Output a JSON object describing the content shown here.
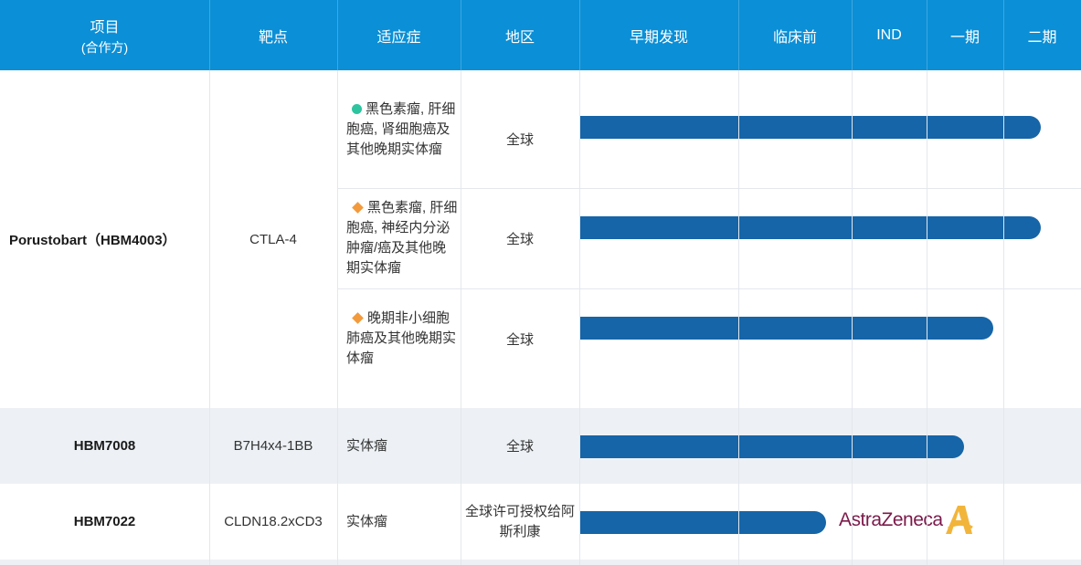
{
  "header": {
    "project": "项目",
    "project_sub": "(合作方)",
    "target": "靶点",
    "indication": "适应症",
    "region": "地区",
    "stages": [
      "早期发现",
      "临床前",
      "IND",
      "一期",
      "二期"
    ]
  },
  "rows": [
    {
      "project": "Porustobart（HBM4003）",
      "target": "CTLA-4",
      "sub_rows": [
        {
          "marker": "circle",
          "indication": "黑色素瘤, 肝细胞癌, 肾细胞癌及其他晚期实体瘤",
          "region": "全球",
          "progress_stage_fraction": 0.95
        },
        {
          "marker": "diamond",
          "indication": "黑色素瘤, 肝细胞癌, 神经内分泌肿瘤/癌及其他晚期实体瘤",
          "region": "全球",
          "progress_stage_fraction": 0.95
        },
        {
          "marker": "diamond",
          "indication": "晚期非小细胞肺癌及其他晚期实体瘤",
          "region": "全球",
          "progress_stage_fraction": 0.85
        }
      ]
    },
    {
      "project": "HBM7008",
      "target": "B7H4x4-1BB",
      "indication": "实体瘤",
      "region": "全球",
      "progress_stage_fraction": 0.78
    },
    {
      "project": "HBM7022",
      "target": "CLDN18.2xCD3",
      "indication": "实体瘤",
      "region": "全球许可授权给阿斯利康",
      "progress_stage_fraction": 0.51,
      "partner_logo": "AstraZeneca"
    }
  ],
  "colors": {
    "header_bg": "#0b8fd6",
    "bar": "#1565a8",
    "alt_row": "#edf1f5",
    "circle_marker": "#2ec4a0",
    "diamond_marker": "#f39a3c",
    "logo_text": "#7b1a4a",
    "logo_mark": "#f2b53b"
  }
}
